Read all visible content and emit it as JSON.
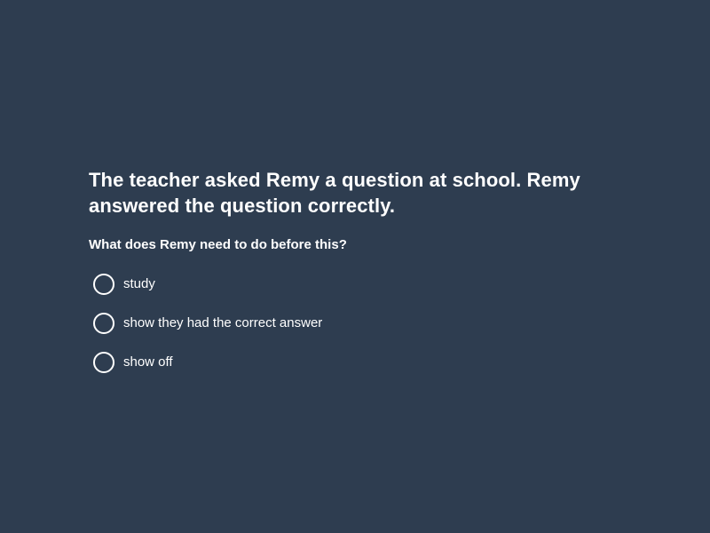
{
  "colors": {
    "background": "#2e3d50",
    "text": "#ffffff"
  },
  "question": {
    "title": "The teacher asked Remy a question at school. Remy answered the question correctly.",
    "prompt": "What does Remy need to do before this?",
    "options": [
      {
        "label": "study",
        "selected": false
      },
      {
        "label": "show they had the correct answer",
        "selected": false
      },
      {
        "label": "show off",
        "selected": false
      }
    ]
  }
}
